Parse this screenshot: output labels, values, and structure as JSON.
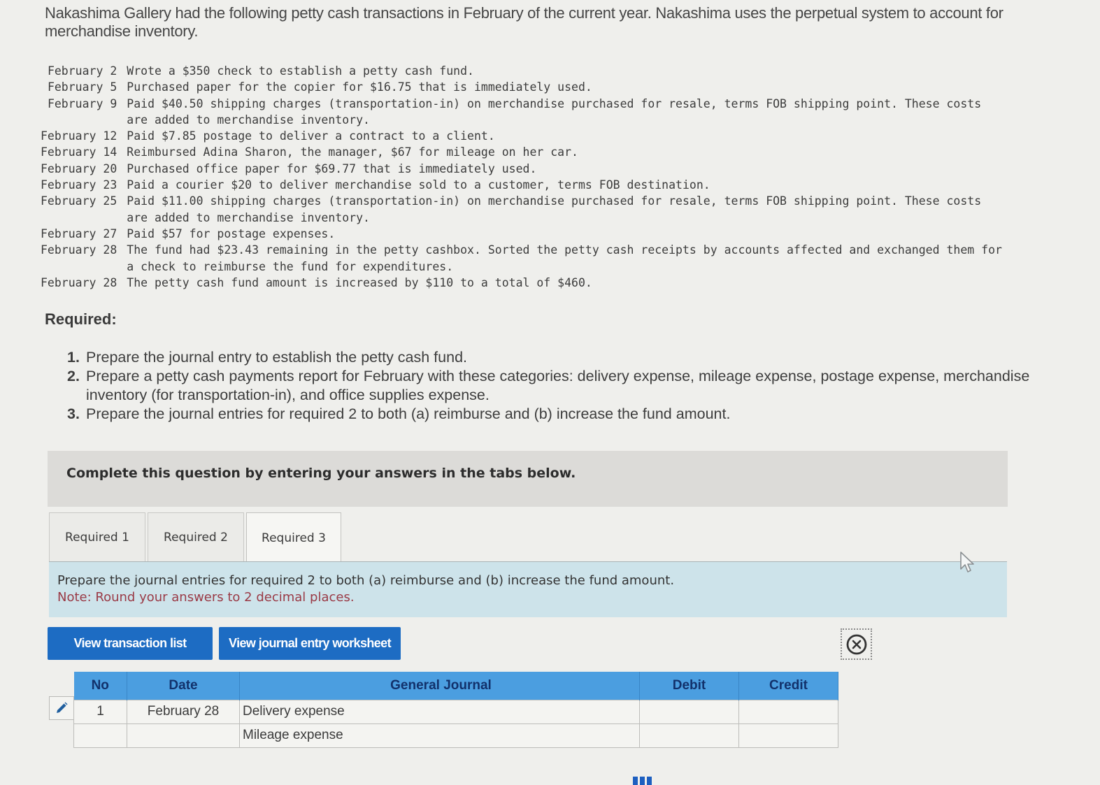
{
  "intro": "Nakashima Gallery had the following petty cash transactions in February of the current year. Nakashima uses the perpetual system to account for merchandise inventory.",
  "transactions": [
    {
      "date": "February 2",
      "description": "Wrote a $350 check to establish a petty cash fund."
    },
    {
      "date": "February 5",
      "description": "Purchased paper for the copier for $16.75 that is immediately used."
    },
    {
      "date": "February 9",
      "description": "Paid $40.50 shipping charges (transportation-in) on merchandise purchased for resale, terms FOB shipping point. These costs are added to merchandise inventory."
    },
    {
      "date": "February 12",
      "description": "Paid $7.85 postage to deliver a contract to a client."
    },
    {
      "date": "February 14",
      "description": "Reimbursed Adina Sharon, the manager, $67 for mileage on her car."
    },
    {
      "date": "February 20",
      "description": "Purchased office paper for $69.77 that is immediately used."
    },
    {
      "date": "February 23",
      "description": "Paid a courier $20 to deliver merchandise sold to a customer, terms FOB destination."
    },
    {
      "date": "February 25",
      "description": "Paid $11.00 shipping charges (transportation-in) on merchandise purchased for resale, terms FOB shipping point. These costs are added to merchandise inventory."
    },
    {
      "date": "February 27",
      "description": "Paid $57 for postage expenses."
    },
    {
      "date": "February 28",
      "description": "The fund had $23.43 remaining in the petty cashbox. Sorted the petty cash receipts by accounts affected and exchanged them for a check to reimburse the fund for expenditures."
    },
    {
      "date": "February 28",
      "description": "The petty cash fund amount is increased by $110 to a total of $460."
    }
  ],
  "required": {
    "heading": "Required:",
    "items": [
      {
        "num": "1.",
        "text": "Prepare the journal entry to establish the petty cash fund."
      },
      {
        "num": "2.",
        "text": "Prepare a petty cash payments report for February with these categories: delivery expense, mileage expense, postage expense, merchandise inventory (for transportation-in), and office supplies expense."
      },
      {
        "num": "3.",
        "text": "Prepare the journal entries for required 2 to both (a) reimburse and (b) increase the fund amount."
      }
    ]
  },
  "complete_banner": "Complete this question by entering your answers in the tabs below.",
  "tabs": [
    {
      "label": "Required 1",
      "active": false
    },
    {
      "label": "Required 2",
      "active": false
    },
    {
      "label": "Required 3",
      "active": true
    }
  ],
  "instructions": {
    "line1": "Prepare the journal entries for required 2 to both (a) reimburse and (b) increase the fund amount.",
    "note": "Note: Round your answers to 2 decimal places."
  },
  "buttons": {
    "view_transaction_list": "View transaction list",
    "view_journal_worksheet": "View journal entry worksheet"
  },
  "journal": {
    "headers": {
      "no": "No",
      "date": "Date",
      "account": "General Journal",
      "debit": "Debit",
      "credit": "Credit"
    },
    "rows": [
      {
        "no": "1",
        "date": "February 28",
        "account": "Delivery expense",
        "debit": "",
        "credit": ""
      },
      {
        "no": "",
        "date": "",
        "account": "Mileage expense",
        "debit": "",
        "credit": ""
      }
    ]
  },
  "colors": {
    "button_blue": "#1d6cc3",
    "header_blue": "#4b9ee0",
    "instructions_bg": "#cde3ea",
    "note_red": "#9a3a46"
  }
}
